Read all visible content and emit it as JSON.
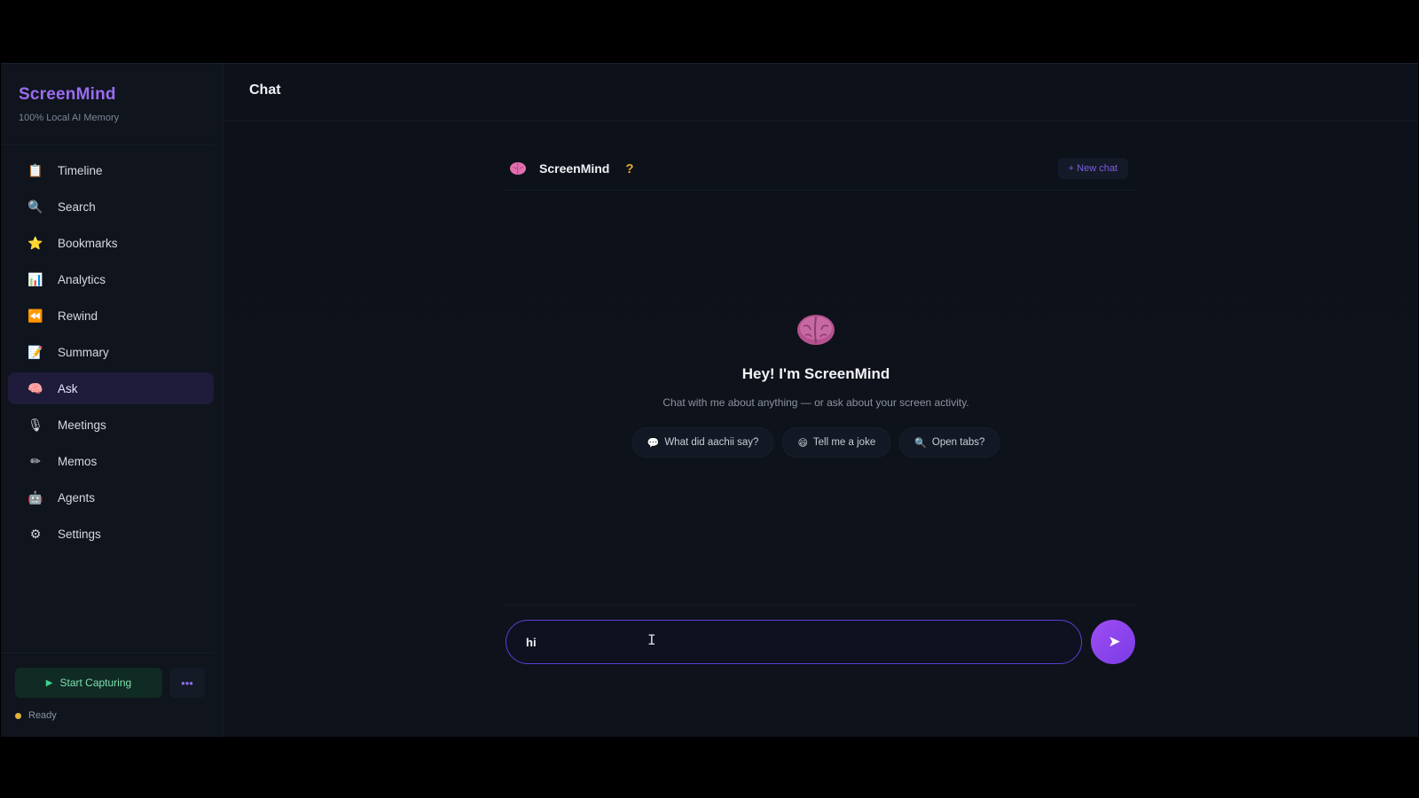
{
  "sidebar": {
    "brand": "ScreenMind",
    "tagline": "100% Local AI Memory",
    "items": [
      {
        "label": "Timeline",
        "icon": "clipboard-icon",
        "glyph": "📋"
      },
      {
        "label": "Search",
        "icon": "search-icon",
        "glyph": "🔍"
      },
      {
        "label": "Bookmarks",
        "icon": "star-icon",
        "glyph": "⭐"
      },
      {
        "label": "Analytics",
        "icon": "bar-chart-icon",
        "glyph": "📊"
      },
      {
        "label": "Rewind",
        "icon": "rewind-icon",
        "glyph": "⏪"
      },
      {
        "label": "Summary",
        "icon": "memo-icon",
        "glyph": "📝"
      },
      {
        "label": "Ask",
        "icon": "brain-icon",
        "glyph": "🧠",
        "active": true
      },
      {
        "label": "Meetings",
        "icon": "microphone-icon",
        "glyph": "🎙"
      },
      {
        "label": "Memos",
        "icon": "pencil-icon",
        "glyph": "✏"
      },
      {
        "label": "Agents",
        "icon": "robot-icon",
        "glyph": "🤖"
      },
      {
        "label": "Settings",
        "icon": "gear-icon",
        "glyph": "⚙"
      }
    ],
    "start_capturing": "Start Capturing",
    "more": "•••",
    "status": "Ready"
  },
  "header": {
    "title": "Chat"
  },
  "chat": {
    "name": "ScreenMind",
    "help": "?",
    "new_chat": "+ New chat",
    "welcome_title": "Hey! I'm ScreenMind",
    "welcome_sub": "Chat with me about anything — or ask about your screen activity.",
    "chips": [
      {
        "icon": "speech-bubble-icon",
        "glyph": "💬",
        "label": "What did aachii say?"
      },
      {
        "icon": "grinning-face-icon",
        "glyph": "😄",
        "label": "Tell me a joke"
      },
      {
        "icon": "search-icon",
        "glyph": "🔍",
        "label": "Open tabs?"
      }
    ],
    "input_value": "hi",
    "send": "➤"
  },
  "colors": {
    "accent": "#9b6cf0",
    "send_button": "#8b45ec",
    "status_ready": "#e3b23c",
    "capture_text": "#7fe2b0"
  }
}
